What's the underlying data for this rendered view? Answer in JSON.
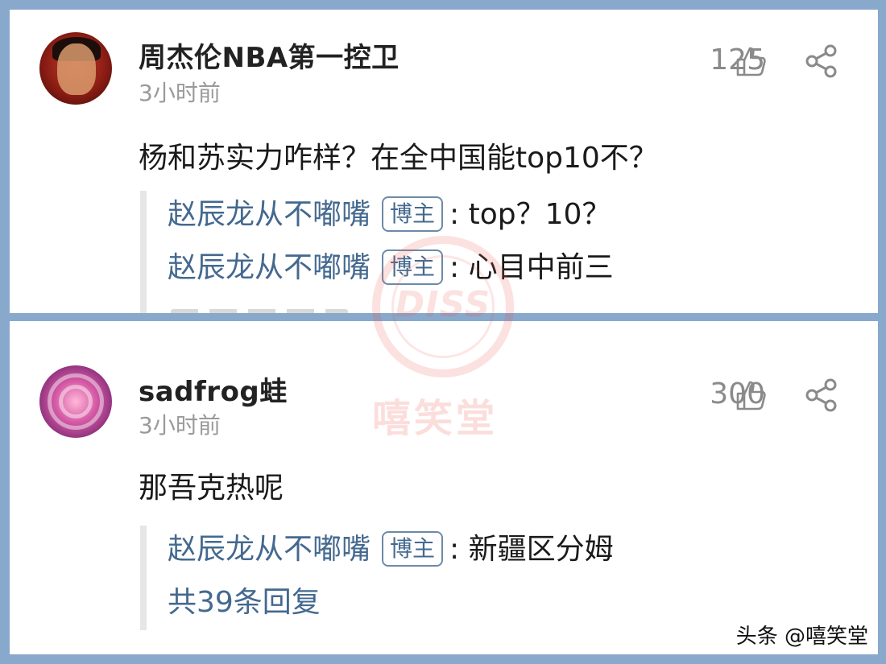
{
  "comments": [
    {
      "username": "周杰伦NBA第一控卫",
      "time": "3小时前",
      "likes": "125",
      "text": "杨和苏实力咋样？在全中国能top10不？",
      "replies": [
        {
          "author": "赵辰龙从不嘟嘴",
          "tag": "博主",
          "text": "top？10？"
        },
        {
          "author": "赵辰龙从不嘟嘴",
          "tag": "博主",
          "text": "心目中前三"
        }
      ]
    },
    {
      "username": "sadfrog蛙",
      "time": "3小时前",
      "likes": "300",
      "text": "那吾克热呢",
      "replies": [
        {
          "author": "赵辰龙从不嘟嘴",
          "tag": "博主",
          "text": "新疆区分姆"
        }
      ],
      "more_replies": "共39条回复"
    }
  ],
  "watermark": {
    "logo_text": "DISS",
    "name": "嘻笑堂"
  },
  "source_credit": "头条 @嘻笑堂",
  "icons": {
    "like": "thumbs-up-icon",
    "share": "share-icon"
  },
  "colors": {
    "background": "#88a8cc",
    "link": "#44698f",
    "watermark": "#eb5a50"
  }
}
